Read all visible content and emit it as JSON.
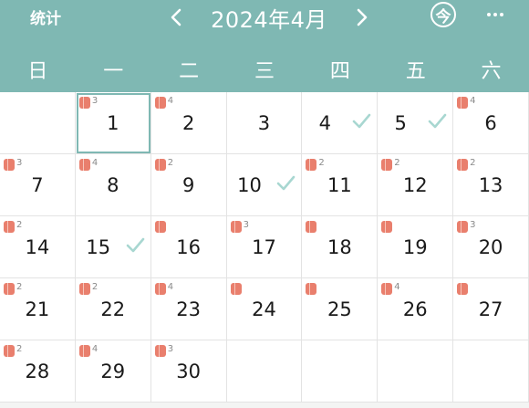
{
  "header": {
    "stats_label": "统计",
    "month_title": "2024年4月",
    "today_label": "今",
    "colors": {
      "header_bg": "#7fb8b3",
      "roll": "#e97f6d",
      "check": "#a8d7d1"
    }
  },
  "weekdays": [
    "日",
    "一",
    "二",
    "三",
    "四",
    "五",
    "六"
  ],
  "days": [
    {
      "day": "",
      "count": null,
      "checked": false
    },
    {
      "day": "1",
      "count": "3",
      "checked": false,
      "selected": true
    },
    {
      "day": "2",
      "count": "4",
      "checked": false
    },
    {
      "day": "3",
      "count": null,
      "checked": false
    },
    {
      "day": "4",
      "count": null,
      "checked": true
    },
    {
      "day": "5",
      "count": null,
      "checked": true
    },
    {
      "day": "6",
      "count": "4",
      "checked": false
    },
    {
      "day": "7",
      "count": "3",
      "checked": false
    },
    {
      "day": "8",
      "count": "4",
      "checked": false
    },
    {
      "day": "9",
      "count": "2",
      "checked": false
    },
    {
      "day": "10",
      "count": null,
      "checked": true
    },
    {
      "day": "11",
      "count": "2",
      "checked": false
    },
    {
      "day": "12",
      "count": "2",
      "checked": false
    },
    {
      "day": "13",
      "count": "2",
      "checked": false
    },
    {
      "day": "14",
      "count": "2",
      "checked": false
    },
    {
      "day": "15",
      "count": null,
      "checked": true
    },
    {
      "day": "16",
      "count": "",
      "checked": false
    },
    {
      "day": "17",
      "count": "3",
      "checked": false
    },
    {
      "day": "18",
      "count": "",
      "checked": false
    },
    {
      "day": "19",
      "count": "",
      "checked": false
    },
    {
      "day": "20",
      "count": "3",
      "checked": false
    },
    {
      "day": "21",
      "count": "2",
      "checked": false
    },
    {
      "day": "22",
      "count": "2",
      "checked": false
    },
    {
      "day": "23",
      "count": "4",
      "checked": false
    },
    {
      "day": "24",
      "count": "",
      "checked": false
    },
    {
      "day": "25",
      "count": "",
      "checked": false
    },
    {
      "day": "26",
      "count": "4",
      "checked": false
    },
    {
      "day": "27",
      "count": "",
      "checked": false
    },
    {
      "day": "28",
      "count": "2",
      "checked": false
    },
    {
      "day": "29",
      "count": "4",
      "checked": false
    },
    {
      "day": "30",
      "count": "3",
      "checked": false
    },
    {
      "day": "",
      "count": null,
      "checked": false
    },
    {
      "day": "",
      "count": null,
      "checked": false
    },
    {
      "day": "",
      "count": null,
      "checked": false
    },
    {
      "day": "",
      "count": null,
      "checked": false
    }
  ]
}
